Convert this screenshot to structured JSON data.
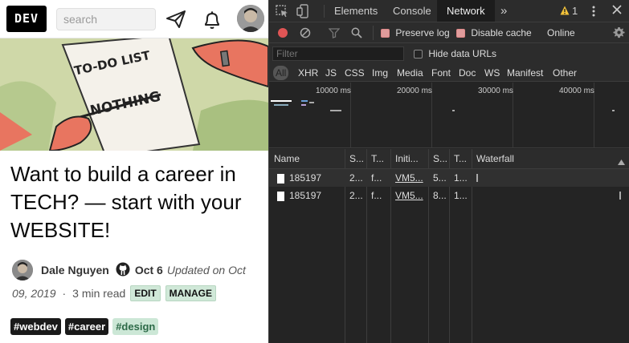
{
  "site": {
    "logo": "DEV",
    "search_placeholder": "search"
  },
  "cover": {
    "note_line1": "TO-DO LIST",
    "note_line2": "NOTHING"
  },
  "article": {
    "title": "Want to build a career in TECH? — start with your WEBSITE!",
    "author": "Dale Nguyen",
    "date": "Oct 6",
    "updated_prefix": "Updated on Oct",
    "updated_date": "09, 2019",
    "dot": "·",
    "read_time": "3 min read",
    "edit_label": "EDIT",
    "manage_label": "MANAGE",
    "tags": [
      "#webdev",
      "#career",
      "#design"
    ]
  },
  "devtools": {
    "tabs": [
      "Elements",
      "Console",
      "Network"
    ],
    "active_tab": "Network",
    "more": "»",
    "warning_count": "1",
    "toolbar": {
      "preserve_log": "Preserve log",
      "disable_cache": "Disable cache",
      "throttling": "Online"
    },
    "filter_placeholder": "Filter",
    "hide_data_urls": "Hide data URLs",
    "types": [
      "All",
      "XHR",
      "JS",
      "CSS",
      "Img",
      "Media",
      "Font",
      "Doc",
      "WS",
      "Manifest",
      "Other"
    ],
    "timeline_labels": [
      "10000 ms",
      "20000 ms",
      "30000 ms",
      "40000 ms"
    ],
    "columns": [
      "Name",
      "S...",
      "T...",
      "Initi...",
      "S...",
      "T...",
      "Waterfall"
    ],
    "requests": [
      {
        "name": "185197",
        "status": "2...",
        "type": "f...",
        "initiator": "VM5...",
        "size": "5...",
        "time": "1..."
      },
      {
        "name": "185197",
        "status": "2...",
        "type": "f...",
        "initiator": "VM5...",
        "size": "8...",
        "time": "1..."
      }
    ],
    "colors": {
      "bg": "#242424",
      "panel": "#2c2c2c",
      "record": "#e05555"
    }
  }
}
